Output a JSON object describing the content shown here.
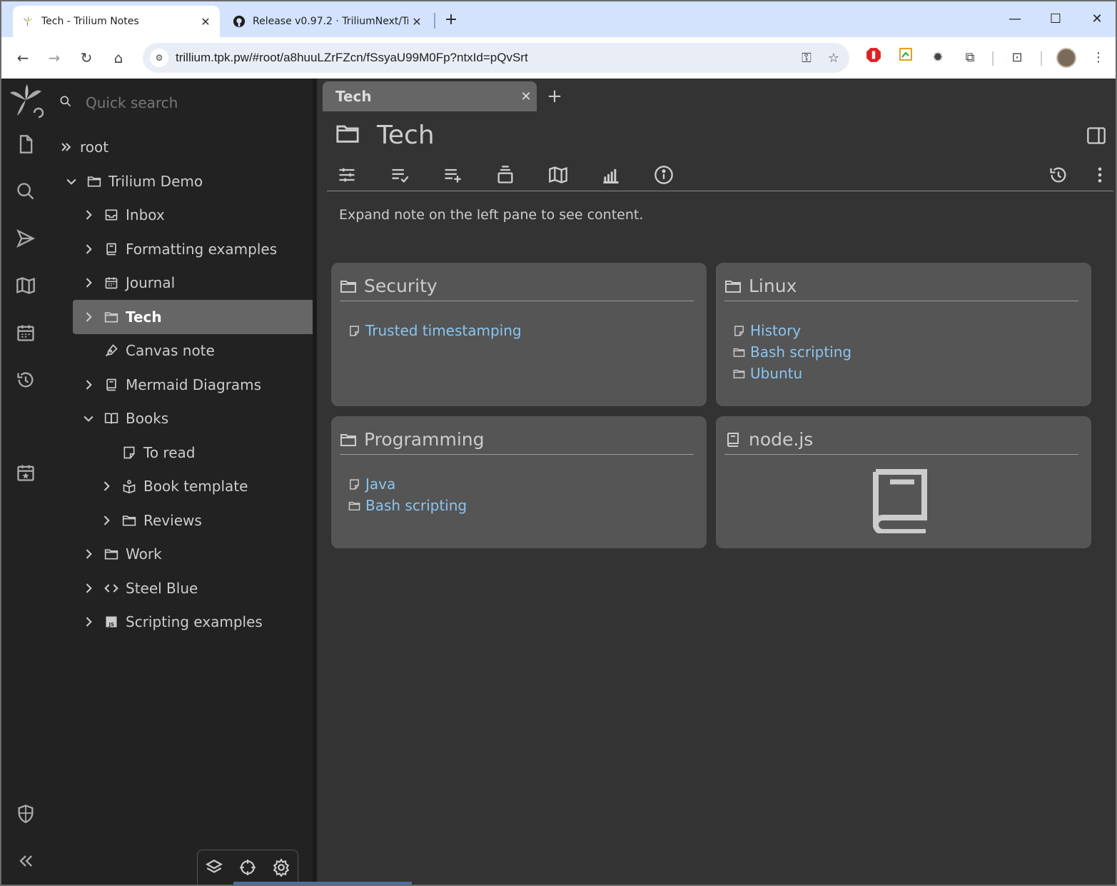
{
  "browser": {
    "tabs": [
      {
        "title": "Tech - Trilium Notes",
        "favicon": "trilium-leaf-icon",
        "active": true
      },
      {
        "title": "Release v0.97.2 · TriliumNext/Tri",
        "favicon": "github-icon",
        "active": false
      }
    ],
    "url": "trillium.tpk.pw/#root/a8huuLZrFZcn/fSsyaU99M0Fp?ntxId=pQvSrt"
  },
  "sidebar": {
    "search_placeholder": "Quick search",
    "tree": [
      {
        "label": "root",
        "icon": "double-chevron-icon",
        "level": 0
      },
      {
        "label": "Trilium Demo",
        "icon": "folder-icon",
        "level": 1,
        "expanded": true
      },
      {
        "label": "Inbox",
        "icon": "inbox-icon",
        "level": 2
      },
      {
        "label": "Formatting examples",
        "icon": "book-icon",
        "level": 2
      },
      {
        "label": "Journal",
        "icon": "calendar-icon",
        "level": 2
      },
      {
        "label": "Tech",
        "icon": "folder-icon",
        "level": 2,
        "selected": true
      },
      {
        "label": "Canvas note",
        "icon": "pen-icon",
        "level": 2
      },
      {
        "label": "Mermaid Diagrams",
        "icon": "book-icon",
        "level": 2
      },
      {
        "label": "Books",
        "icon": "open-book-icon",
        "level": 2,
        "expanded": true
      },
      {
        "label": "To read",
        "icon": "note-icon",
        "level": 3
      },
      {
        "label": "Book template",
        "icon": "reader-icon",
        "level": 3
      },
      {
        "label": "Reviews",
        "icon": "folder-icon",
        "level": 3
      },
      {
        "label": "Work",
        "icon": "folder-icon",
        "level": 2
      },
      {
        "label": "Steel Blue",
        "icon": "code-icon",
        "level": 2
      },
      {
        "label": "Scripting examples",
        "icon": "js-icon",
        "level": 2
      }
    ]
  },
  "note": {
    "tab_title": "Tech",
    "title": "Tech",
    "hint": "Expand note on the left pane to see content.",
    "cards": [
      {
        "title": "Security",
        "icon": "folder-icon",
        "links": [
          {
            "label": "Trusted timestamping",
            "icon": "note-icon"
          }
        ]
      },
      {
        "title": "Linux",
        "icon": "folder-icon",
        "links": [
          {
            "label": "History",
            "icon": "note-icon"
          },
          {
            "label": "Bash scripting",
            "icon": "folder-icon"
          },
          {
            "label": "Ubuntu",
            "icon": "folder-icon"
          }
        ]
      },
      {
        "title": "Programming",
        "icon": "folder-icon",
        "links": [
          {
            "label": "Java",
            "icon": "note-icon"
          },
          {
            "label": "Bash scripting",
            "icon": "folder-icon"
          }
        ]
      },
      {
        "title": "node.js",
        "icon": "book-icon",
        "links": []
      }
    ]
  },
  "colors": {
    "app_bg": "#333333",
    "tree_bg": "#222222",
    "selected_bg": "#666666",
    "card_bg": "#555555",
    "link": "#8ac5f0",
    "browser_tabstrip": "#d3e3fd"
  }
}
